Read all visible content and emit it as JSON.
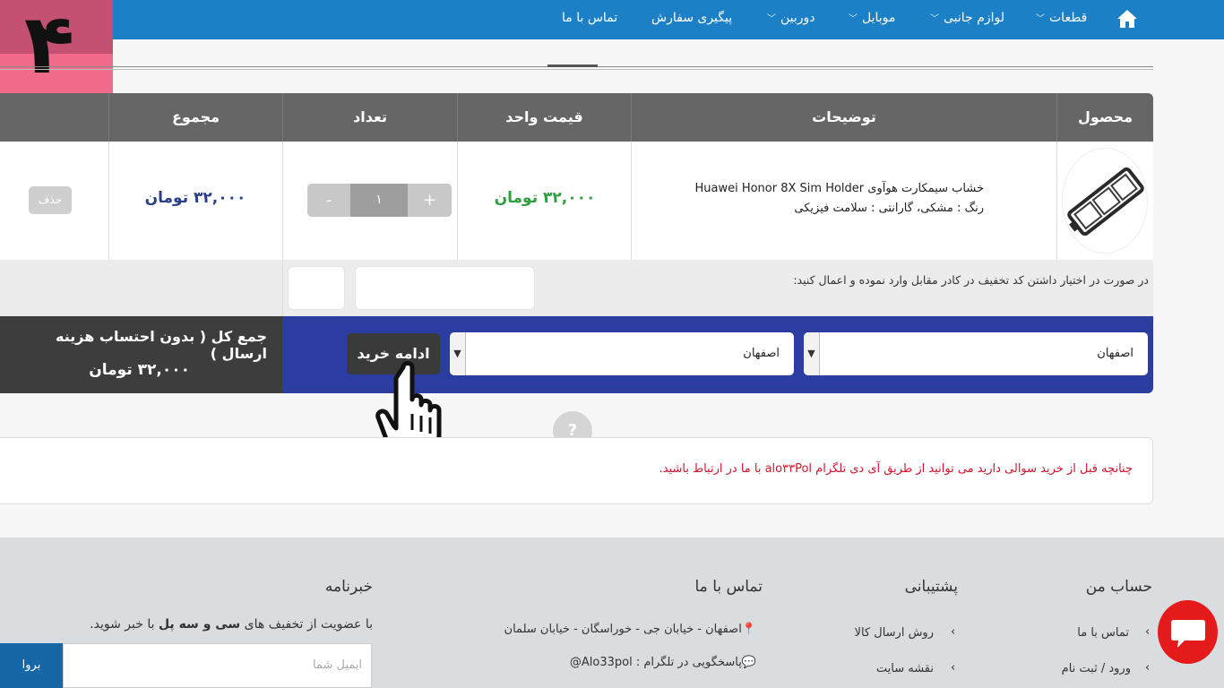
{
  "nav": {
    "contact": "تماس با ما",
    "tracking": "پیگیری سفارش",
    "camera": "دوربین",
    "mobile": "موبایل",
    "accessories": "لوازم جانبی",
    "parts": "قطعات"
  },
  "badge": {
    "number": "۴"
  },
  "table": {
    "headers": {
      "product": "محصول",
      "description": "توضیحات",
      "unit_price": "قیمت واحد",
      "quantity": "تعداد",
      "total": "مجموع"
    },
    "row": {
      "title": "خشاب سیمکارت هوآوی Huawei Honor 8X Sim Holder",
      "attributes": "رنگ : مشکی، گارانتی : سلامت فیزیکی",
      "unit_price": "۳۲,۰۰۰ تومان",
      "quantity": "۱",
      "minus": "-",
      "plus": "+",
      "total": "۳۲,۰۰۰ تومان",
      "delete": "حذف"
    }
  },
  "discount": {
    "text": "در صورت در اختیار داشتن کد تخفیف در کادر مقابل وارد نموده و اعمال کنید:"
  },
  "checkout": {
    "province": "اصفهان",
    "city": "اصفهان",
    "continue": "ادامه خرید",
    "grand_label": "جمع کل ( بدون احتساب هزینه ارسال )",
    "grand_value": "۳۲,۰۰۰ تومان"
  },
  "help": "?",
  "notice": "چنانچه قبل از خرید سوالی دارید می توانید از طریق آی دی تلگرام alo۳۳Pol با ما در ارتباط باشید.",
  "footer": {
    "account": {
      "title": "حساب من",
      "items": [
        "تماس با ما",
        "ورود / ثبت نام"
      ]
    },
    "support": {
      "title": "پشتیبانی",
      "items": [
        "روش ارسال کالا",
        "نقشه سایت"
      ]
    },
    "contact": {
      "title": "تماس با ما",
      "address": "اصفهان - خیابان جی - خوراسگان - خیابان سلمان",
      "telegram": "پاسخگویی در تلگرام : Alo33pol@"
    },
    "newsletter": {
      "title": "خبرنامه",
      "text_before": "با عضویت از تخفیف های ",
      "brand": "سی و سه پل",
      "text_after": " با خبر شوید.",
      "placeholder": "ایمیل شما",
      "button": "بروا"
    }
  },
  "colors": {
    "nav_bg": "#1b80c5",
    "table_header": "#666666",
    "price_green": "#2e9e3f",
    "total_blue": "#2a3f8a",
    "checkout_bar": "#2b3da0",
    "notice_red": "#d0152a",
    "chat_red": "#e51b1b",
    "badge_pink": "#ef6b89"
  }
}
